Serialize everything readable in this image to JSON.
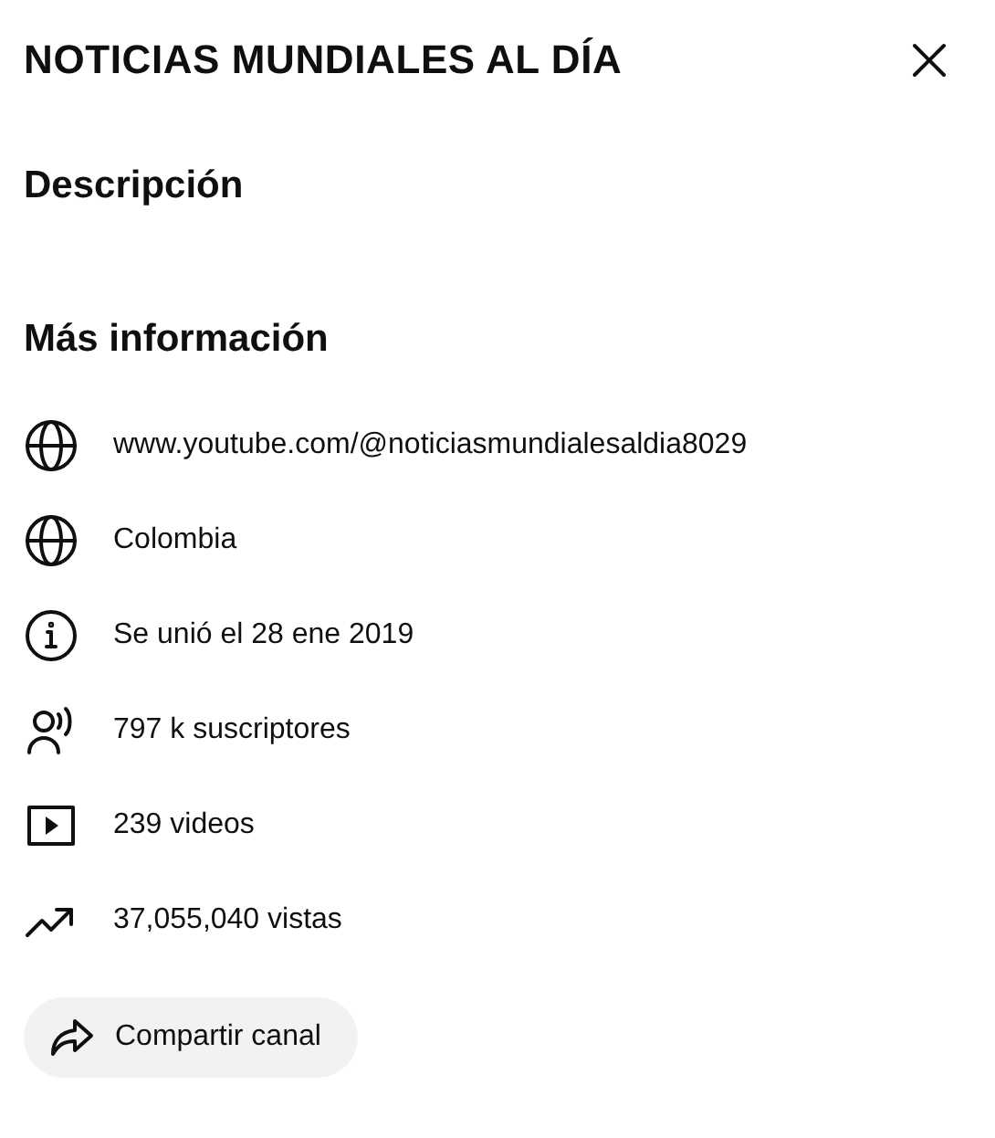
{
  "dialog": {
    "title": "NOTICIAS MUNDIALES AL DÍA"
  },
  "description": {
    "heading": "Descripción"
  },
  "more_info": {
    "heading": "Más información",
    "rows": [
      {
        "kind": "link",
        "text": "www.youtube.com/@noticiasmundialesaldia8029"
      },
      {
        "kind": "country",
        "text": "Colombia"
      },
      {
        "kind": "joined",
        "text": "Se unió el 28 ene 2019"
      },
      {
        "kind": "subscribers",
        "text": "797 k suscriptores"
      },
      {
        "kind": "videos",
        "text": "239 videos"
      },
      {
        "kind": "views",
        "text": "37,055,040 vistas"
      }
    ]
  },
  "share_button": {
    "label": "Compartir canal"
  }
}
